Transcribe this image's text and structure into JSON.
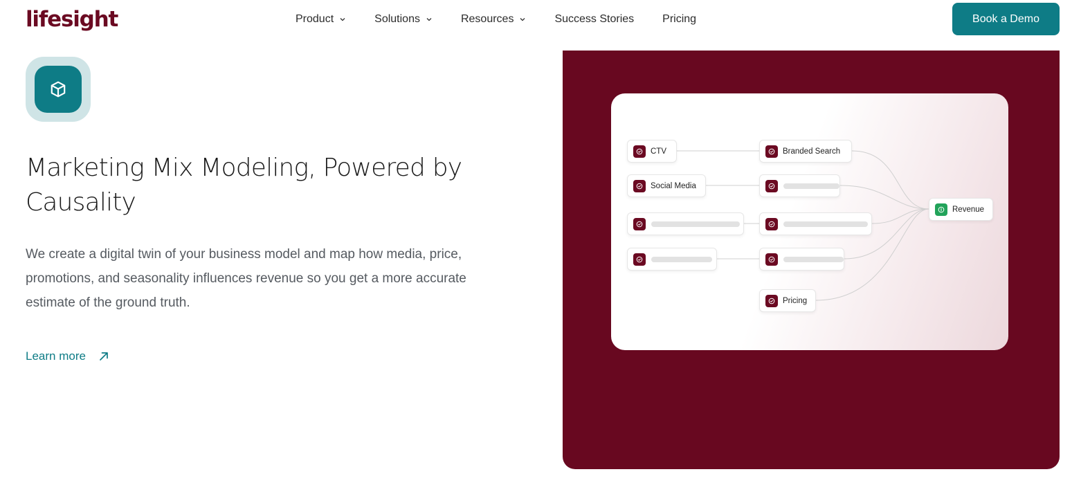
{
  "nav": {
    "logo": "lifesight",
    "menu": [
      {
        "label": "Product",
        "has_dropdown": true
      },
      {
        "label": "Solutions",
        "has_dropdown": true
      },
      {
        "label": "Resources",
        "has_dropdown": true
      },
      {
        "label": "Success Stories",
        "has_dropdown": false
      },
      {
        "label": "Pricing",
        "has_dropdown": false
      }
    ],
    "cta_label": "Book a Demo"
  },
  "hero": {
    "icon": "cube-icon",
    "title": "Marketing Mix Modeling, Powered by Causality",
    "description": "We create a digital twin of your business model and map how media, price, promotions, and seasonality influences revenue so you get a more accurate estimate of the ground truth.",
    "link_label": "Learn more",
    "link_icon": "arrow-up-right-icon"
  },
  "diagram": {
    "nodes": {
      "ctv": "CTV",
      "social_media": "Social Media",
      "branded_search": "Branded Search",
      "pricing": "Pricing",
      "revenue": "Revenue"
    }
  },
  "colors": {
    "brand": "#6b0a22",
    "accent": "#0e7c86",
    "panel": "#680820",
    "success": "#22a35a"
  }
}
